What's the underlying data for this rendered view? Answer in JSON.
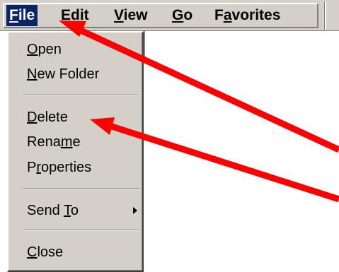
{
  "menubar": {
    "items": [
      {
        "pre": "",
        "mn": "F",
        "post": "ile"
      },
      {
        "pre": "",
        "mn": "E",
        "post": "dit"
      },
      {
        "pre": "",
        "mn": "V",
        "post": "iew"
      },
      {
        "pre": "",
        "mn": "G",
        "post": "o"
      },
      {
        "pre": "F",
        "mn": "a",
        "post": "vorites"
      }
    ]
  },
  "file_menu": {
    "open": {
      "pre": "",
      "mn": "O",
      "post": "pen"
    },
    "new_folder": {
      "pre": "",
      "mn": "N",
      "post": "ew Folder"
    },
    "delete": {
      "pre": "",
      "mn": "D",
      "post": "elete"
    },
    "rename": {
      "pre": "Rena",
      "mn": "m",
      "post": "e"
    },
    "properties": {
      "pre": "P",
      "mn": "r",
      "post": "operties"
    },
    "send_to": {
      "pre": "Send ",
      "mn": "T",
      "post": "o"
    },
    "close": {
      "pre": "",
      "mn": "C",
      "post": "lose"
    }
  },
  "colors": {
    "menu_background": "#d4d0c8",
    "selection": "#0a246a",
    "annotation_arrow": "#ff0000"
  },
  "icons": {
    "submenu": "triangle-right-icon"
  }
}
